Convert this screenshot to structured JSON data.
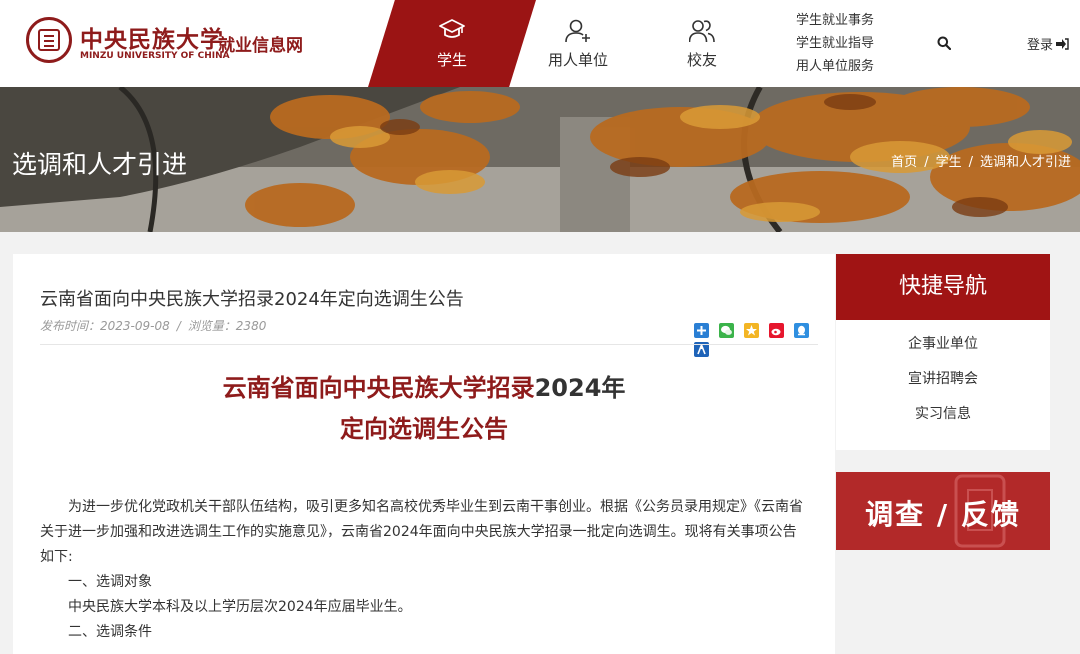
{
  "header": {
    "logo_cn": "中央民族大学",
    "logo_en": "MINZU UNIVERSITY OF CHINA",
    "site_name": "就业信息网",
    "nav": [
      {
        "label": "学生",
        "icon": "graduation-cap-icon",
        "active": true
      },
      {
        "label": "用人单位",
        "icon": "user-add-icon",
        "active": false
      },
      {
        "label": "校友",
        "icon": "users-icon",
        "active": false
      }
    ],
    "sub_links": [
      "学生就业事务",
      "学生就业指导",
      "用人单位服务"
    ],
    "login": "登录",
    "search_icon": "search-icon",
    "login_icon": "sign-in-icon"
  },
  "banner": {
    "title": "选调和人才引进",
    "breadcrumb": [
      "首页",
      "学生",
      "选调和人才引进"
    ],
    "separator": "/"
  },
  "article": {
    "title": "云南省面向中央民族大学招录2024年定向选调生公告",
    "meta_date": "发布时间：2023-09-08",
    "meta_sep": "/",
    "meta_views": "浏览量：2380",
    "share_icons": [
      "plus-share-icon",
      "wechat-icon",
      "qzone-icon",
      "weibo-icon",
      "qq-icon",
      "renren-icon"
    ],
    "headline_line1_a": "云南省面向中央民族大学招录",
    "headline_line1_b": "2024年",
    "headline_line2": "定向选调生公告",
    "paragraphs": [
      "为进一步优化党政机关干部队伍结构，吸引更多知名高校优秀毕业生到云南干事创业。根据《公务员录用规定》《云南省关于进一步加强和改进选调生工作的实施意见》，云南省2024年面向中央民族大学招录一批定向选调生。现将有关事项公告如下:",
      "一、选调对象",
      "中央民族大学本科及以上学历层次2024年应届毕业生。",
      "二、选调条件"
    ]
  },
  "sidebar": {
    "quick_title": "快捷导航",
    "quick_links": [
      "企事业单位",
      "宣讲招聘会",
      "实习信息"
    ],
    "survey_text": "调查 / 反馈"
  },
  "colors": {
    "brand": "#9b1414",
    "nav_active": "#9b1414",
    "headline": "#8e1b1b"
  }
}
